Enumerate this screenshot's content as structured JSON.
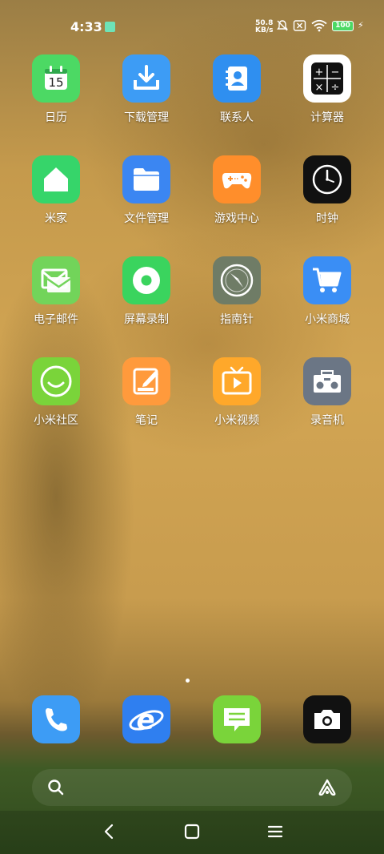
{
  "status_bar": {
    "time": "4:33",
    "net_speed_value": "50.8",
    "net_speed_unit": "KB/s",
    "battery_level": "100",
    "icons": [
      "notification-app-icon",
      "silent-bell-icon",
      "no-sim-icon",
      "wifi-icon",
      "battery-icon",
      "charging-bolt-icon"
    ]
  },
  "apps": [
    {
      "name": "日历",
      "icon": "calendar-icon",
      "date": "15",
      "color": "#4cd964"
    },
    {
      "name": "下载管理",
      "icon": "download-icon",
      "color": "#3d9cf5"
    },
    {
      "name": "联系人",
      "icon": "contacts-icon",
      "color": "#2f8ff0"
    },
    {
      "name": "计算器",
      "icon": "calculator-icon",
      "color": "#ffffff"
    },
    {
      "name": "米家",
      "icon": "home-icon",
      "color": "#36d56a"
    },
    {
      "name": "文件管理",
      "icon": "folder-icon",
      "color": "#3b86f2"
    },
    {
      "name": "游戏中心",
      "icon": "gamepad-icon",
      "color": "#ff8e2b"
    },
    {
      "name": "时钟",
      "icon": "clock-icon",
      "color": "#111111"
    },
    {
      "name": "电子邮件",
      "icon": "mail-icon",
      "color": "#72d45a"
    },
    {
      "name": "屏幕录制",
      "icon": "screen-record-icon",
      "color": "#3ad45e"
    },
    {
      "name": "指南针",
      "icon": "compass-icon",
      "color": "#6f7c66"
    },
    {
      "name": "小米商城",
      "icon": "cart-icon",
      "color": "#3a8ef5"
    },
    {
      "name": "小米社区",
      "icon": "community-icon",
      "color": "#7ad43a"
    },
    {
      "name": "笔记",
      "icon": "notes-icon",
      "color": "#ff9a3c"
    },
    {
      "name": "小米视频",
      "icon": "video-icon",
      "color": "#ffa82a"
    },
    {
      "name": "录音机",
      "icon": "recorder-icon",
      "color": "#6b7685"
    }
  ],
  "dock": [
    {
      "icon": "phone-icon",
      "color": "#3d9cf5"
    },
    {
      "icon": "browser-icon",
      "color": "#2f7ff0"
    },
    {
      "icon": "messages-icon",
      "color": "#7ad43a"
    },
    {
      "icon": "camera-icon",
      "color": "#111111"
    }
  ],
  "page_indicator": {
    "current": 1,
    "total": 1
  },
  "navigation": [
    "back-icon",
    "home-icon",
    "recents-icon"
  ]
}
